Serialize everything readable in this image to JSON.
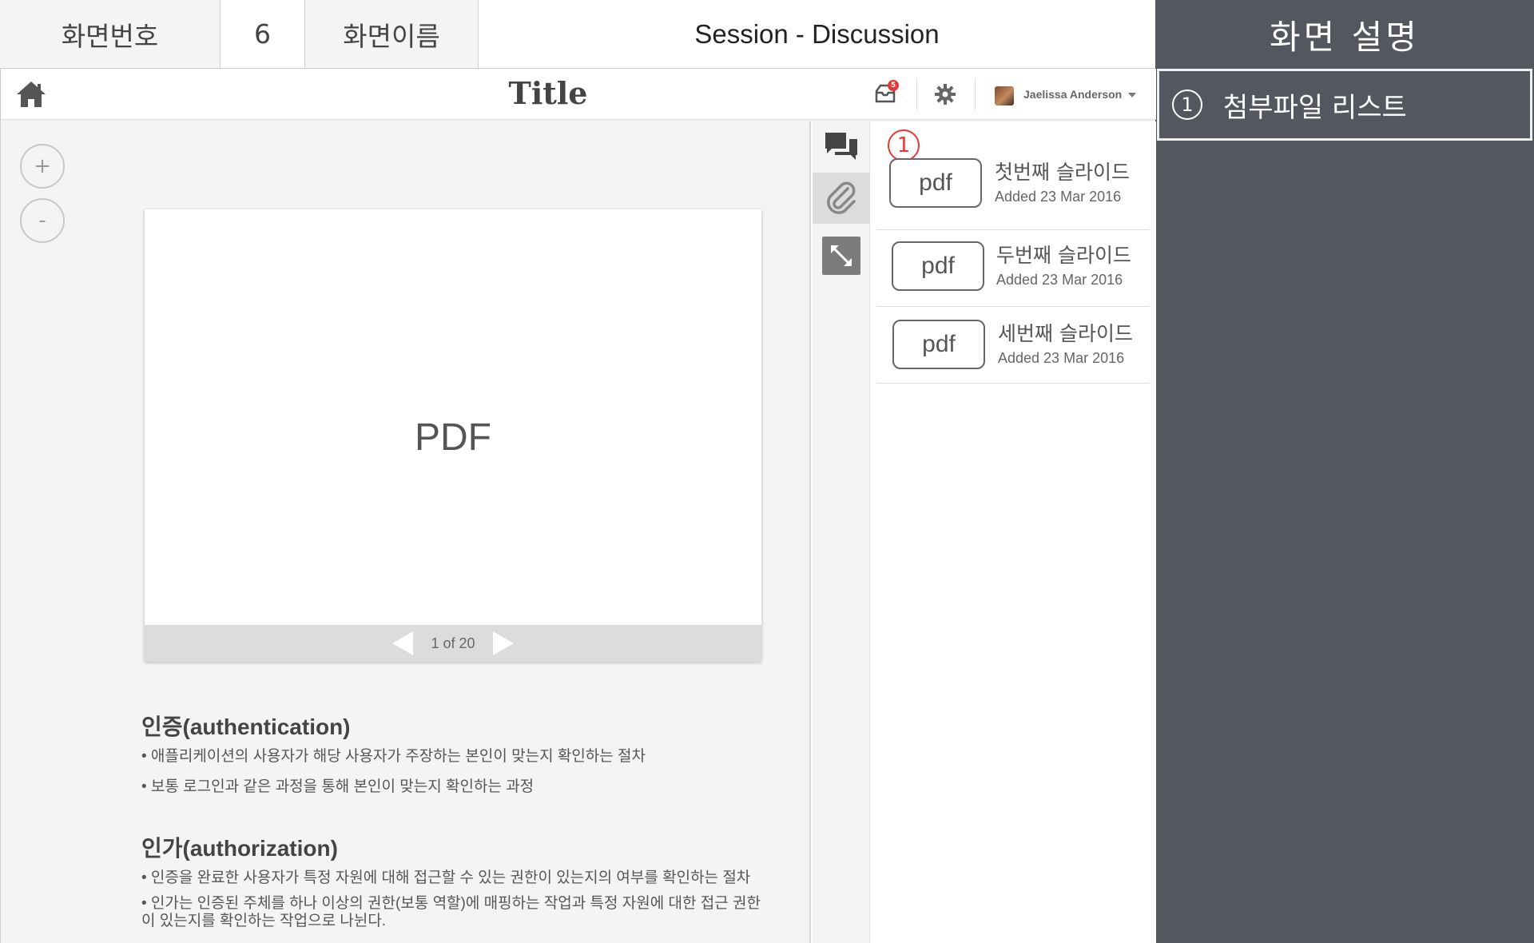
{
  "storyboard": {
    "screen_number_label": "화면번호",
    "screen_number": "6",
    "screen_name_label": "화면이름",
    "screen_name": "Session - Discussion",
    "description_title": "화면 설명",
    "description_items": [
      {
        "marker": "1",
        "text": "첨부파일 리스트"
      }
    ]
  },
  "topbar": {
    "home_icon": "home-icon",
    "title": "Title",
    "notification_icon": "inbox-icon",
    "notification_count": "5",
    "settings_icon": "gear-icon",
    "user_name": "Jaelissa Anderson"
  },
  "viewer": {
    "zoom_in": "+",
    "zoom_out": "-",
    "pdf_label": "PDF",
    "page_indicator": "1 of 20"
  },
  "notes": [
    {
      "heading": "인증(authentication)",
      "lines": [
        "• 애플리케이션의 사용자가 해당 사용자가 주장하는 본인이 맞는지 확인하는 절차",
        "• 보통 로그인과 같은 과정을 통해 본인이 맞는지 확인하는 과정"
      ]
    },
    {
      "heading": "인가(authorization)",
      "lines": [
        "• 인증을 완료한 사용자가 특정 자원에 대해 접근할 수 있는 권한이 있는지의 여부를 확인하는 절차",
        "• 인가는 인증된 주체를 하나 이상의 권한(보통 역할)에 매핑하는 작업과 특정 자원에 대한 접근 권한이 있는지를 확인하는 작업으로 나뉜다."
      ]
    }
  ],
  "side_tools": [
    "chat-icon",
    "paperclip-icon",
    "expand-icon"
  ],
  "attachments": {
    "marker": "1",
    "items": [
      {
        "type": "pdf",
        "name": "첫번째 슬라이드",
        "added": "Added 23 Mar 2016"
      },
      {
        "type": "pdf",
        "name": "두번째 슬라이드",
        "added": "Added 23 Mar 2016"
      },
      {
        "type": "pdf",
        "name": "세번째 슬라이드",
        "added": "Added 23 Mar 2016"
      }
    ]
  },
  "colors": {
    "panel_bg": "#54575f",
    "content_bg": "#f4f4f6",
    "marker_red": "#e53935"
  }
}
